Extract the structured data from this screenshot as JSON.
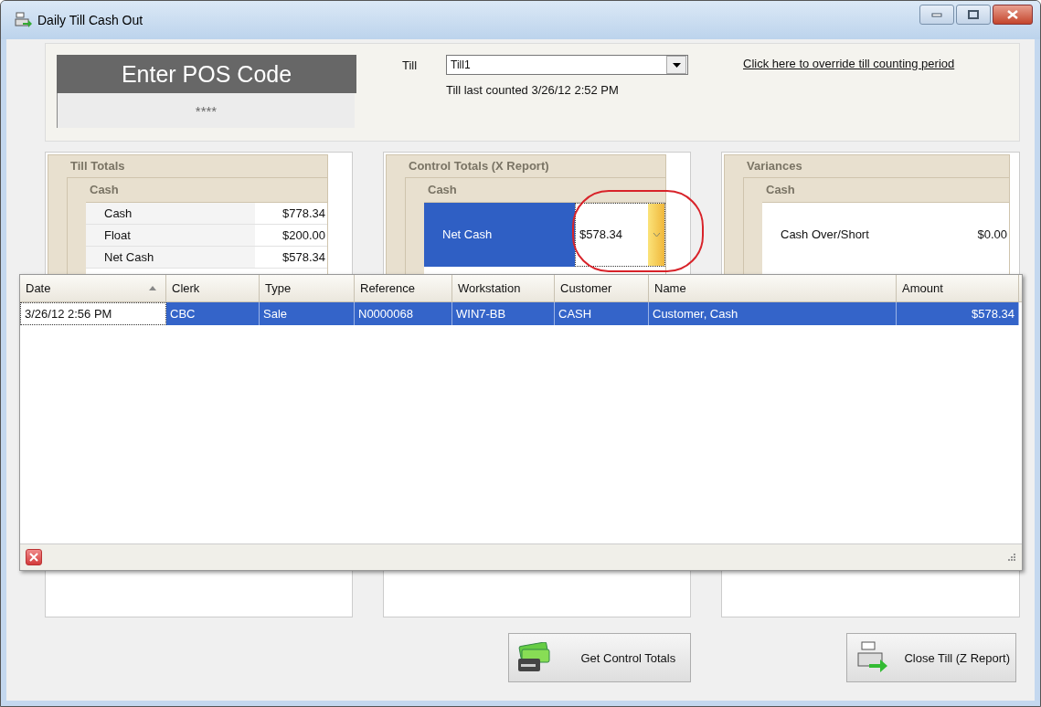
{
  "window": {
    "title": "Daily Till Cash Out"
  },
  "pos_code": {
    "heading": "Enter POS Code",
    "value": "****"
  },
  "till": {
    "label": "Till",
    "value": "Till1",
    "last_counted": "Till last counted 3/26/12 2:52 PM"
  },
  "override_link": "Click here to override till counting period",
  "panels": [
    {
      "title": "Till Totals",
      "group": "Cash",
      "kind": "list",
      "rows": [
        {
          "label": "Cash",
          "value": "$778.34"
        },
        {
          "label": "Float",
          "value": "$200.00"
        },
        {
          "label": "Net Cash",
          "value": "$578.34"
        }
      ]
    },
    {
      "title": "Control Totals (X Report)",
      "group": "Cash",
      "kind": "editor",
      "rows": [
        {
          "label": "Net Cash",
          "value": "$578.34"
        }
      ]
    },
    {
      "title": "Variances",
      "group": "Cash",
      "kind": "single",
      "rows": [
        {
          "label": "Cash Over/Short",
          "value": "$0.00"
        }
      ]
    }
  ],
  "grid": {
    "columns": [
      {
        "label": "Date",
        "sorted": true,
        "kind": "text"
      },
      {
        "label": "Clerk",
        "sorted": false,
        "kind": "text"
      },
      {
        "label": "Type",
        "sorted": false,
        "kind": "text"
      },
      {
        "label": "Reference",
        "sorted": false,
        "kind": "text"
      },
      {
        "label": "Workstation",
        "sorted": false,
        "kind": "text"
      },
      {
        "label": "Customer",
        "sorted": false,
        "kind": "text"
      },
      {
        "label": "Name",
        "sorted": false,
        "kind": "text"
      },
      {
        "label": "Amount",
        "sorted": false,
        "kind": "money"
      }
    ],
    "rows": [
      {
        "selected": true,
        "cells": [
          {
            "text": "3/26/12 2:56 PM",
            "focused": true
          },
          {
            "text": "CBC",
            "focused": false
          },
          {
            "text": "Sale",
            "focused": false
          },
          {
            "text": "N0000068",
            "focused": false
          },
          {
            "text": "WIN7-BB",
            "focused": false
          },
          {
            "text": "CASH",
            "focused": false
          },
          {
            "text": "Customer, Cash",
            "focused": false
          },
          {
            "text": "$578.34",
            "focused": false
          }
        ]
      }
    ]
  },
  "buttons": [
    {
      "label": "Get Control Totals",
      "kind": "money"
    },
    {
      "label": "Close Till (Z Report)",
      "kind": "register"
    }
  ]
}
